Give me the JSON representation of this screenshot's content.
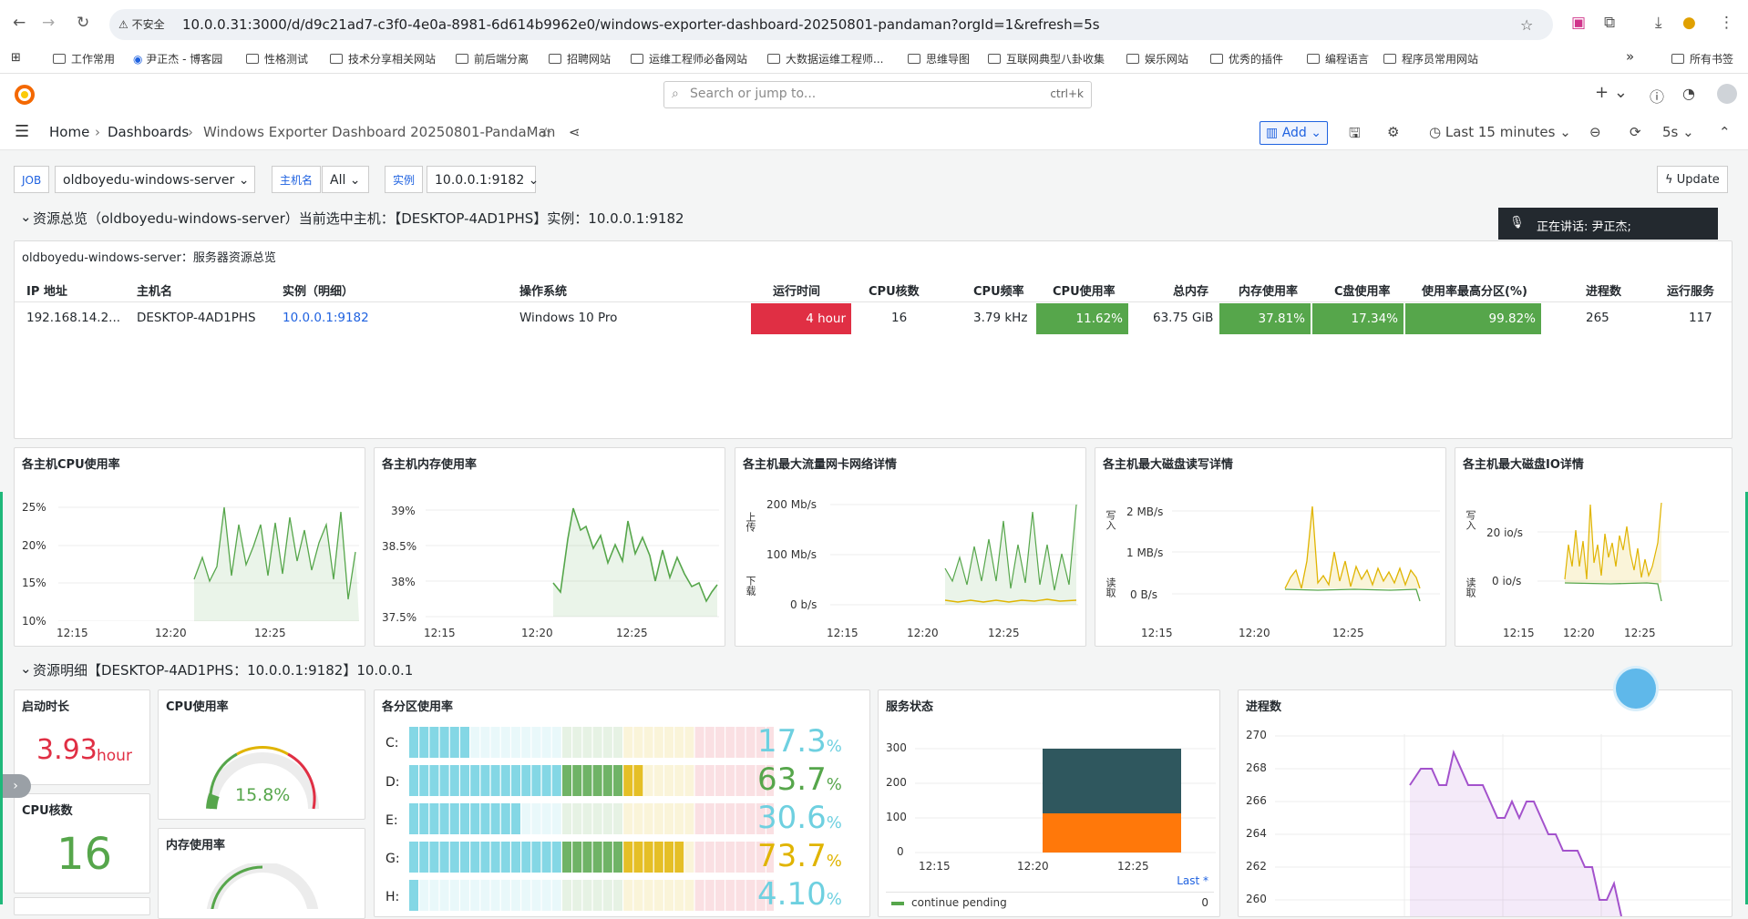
{
  "browser": {
    "insecure_label": "不安全",
    "url": "10.0.0.31:3000/d/d9c21ad7-c3f0-4e0a-8981-6d614b9962e0/windows-exporter-dashboard-20250801-pandaman?orgId=1&refresh=5s",
    "bookmarks": [
      "工作常用",
      "尹正杰 - 博客园",
      "性格测试",
      "技术分享相关网站",
      "前后端分离",
      "招聘网站",
      "运维工程师必备网站",
      "大数据运维工程师...",
      "思维导图",
      "互联网典型八卦收集",
      "娱乐网站",
      "优秀的插件",
      "编程语言",
      "程序员常用网站",
      "所有书签"
    ],
    "more": "»"
  },
  "topbar": {
    "search_placeholder": "Search or jump to...",
    "shortcut": "ctrl+k",
    "plus": "+"
  },
  "breadcrumb": {
    "home": "Home",
    "sep": "›",
    "dashboards": "Dashboards",
    "title": "Windows Exporter Dashboard 20250801-PandaMan"
  },
  "toolbar": {
    "add_label": "Add",
    "time_range": "Last 15 minutes",
    "refresh_interval": "5s",
    "update_label": "Update"
  },
  "variables": [
    {
      "label": "JOB",
      "value": "oldboyedu-windows-server"
    },
    {
      "label": "主机名",
      "value": "All"
    },
    {
      "label": "实例",
      "value": "10.0.0.1:9182"
    }
  ],
  "row1": {
    "title": "资源总览（oldboyedu-windows-server）当前选中主机：【DESKTOP-4AD1PHS】实例：10.0.0.1:9182"
  },
  "talk_overlay": {
    "text": "正在讲话:  尹正杰;"
  },
  "overview_table": {
    "title": "oldboyedu-windows-server：服务器资源总览",
    "headers": [
      "IP 地址",
      "主机名",
      "实例（明细）",
      "操作系统",
      "运行时间",
      "CPU核数",
      "CPU频率",
      "CPU使用率",
      "总内存",
      "内存使用率",
      "C盘使用率",
      "使用率最高分区(%)",
      "进程数",
      "运行服务"
    ],
    "row": [
      "192.168.14.2...",
      "DESKTOP-4AD1PHS",
      "10.0.0.1:9182",
      "Windows 10 Pro",
      "4 hour",
      "16",
      "3.79 kHz",
      "11.62%",
      "63.75 GiB",
      "37.81%",
      "17.34%",
      "99.82%",
      "265",
      "117"
    ],
    "colors": {
      "red": "#e02f44",
      "green": "#56a64b"
    }
  },
  "timeseries_panels": [
    {
      "title": "各主机CPU使用率",
      "yticks": [
        "25%",
        "20%",
        "15%",
        "10%"
      ],
      "xticks": [
        "12:15",
        "12:20",
        "12:25"
      ]
    },
    {
      "title": "各主机内存使用率",
      "yticks": [
        "39%",
        "38.5%",
        "38%",
        "37.5%"
      ],
      "xticks": [
        "12:15",
        "12:20",
        "12:25"
      ]
    },
    {
      "title": "各主机最大流量网卡网络详情",
      "yticks": [
        "200 Mb/s",
        "100 Mb/s",
        "0 b/s"
      ],
      "xticks": [
        "12:15",
        "12:20",
        "12:25"
      ],
      "axis_up": "上传",
      "axis_down": "下载"
    },
    {
      "title": "各主机最大磁盘读写详情",
      "yticks": [
        "2 MB/s",
        "1 MB/s",
        "0 B/s"
      ],
      "xticks": [
        "12:15",
        "12:20",
        "12:25"
      ],
      "axis_up": "写入",
      "axis_down": "读取"
    },
    {
      "title": "各主机最大磁盘IO详情",
      "yticks": [
        "20 io/s",
        "0 io/s"
      ],
      "xticks": [
        "12:15",
        "12:20",
        "12:25"
      ],
      "axis_up": "写入",
      "axis_down": "读取"
    }
  ],
  "row2": {
    "title": "资源明细【DESKTOP-4AD1PHS：10.0.0.1:9182】10.0.0.1"
  },
  "stats": {
    "uptime_title": "启动时长",
    "uptime_value": "3.93",
    "uptime_unit": "hour",
    "cpu_cores_title": "CPU核数",
    "cpu_cores_value": "16",
    "cpu_usage_title": "CPU使用率",
    "cpu_usage_value": "15.8%",
    "cpu_usage_fraction": 0.158,
    "mem_usage_title": "内存使用率"
  },
  "partitions": {
    "title": "各分区使用率",
    "items": [
      {
        "label": "C:",
        "value": "17.3",
        "color": "#6ed0e0"
      },
      {
        "label": "D:",
        "value": "63.7",
        "color": "#56a64b"
      },
      {
        "label": "E:",
        "value": "30.6",
        "color": "#6ed0e0"
      },
      {
        "label": "G:",
        "value": "73.7",
        "color": "#e0b400"
      },
      {
        "label": "H:",
        "value": "4.10",
        "color": "#6ed0e0"
      }
    ],
    "unit": "%"
  },
  "service_state": {
    "title": "服务状态",
    "yticks": [
      "300",
      "200",
      "100",
      "0"
    ],
    "xticks": [
      "12:15",
      "12:20",
      "12:25"
    ],
    "last_label": "Last *",
    "legend_item": "continue pending",
    "legend_value": "0",
    "colors": {
      "top": "#2f575e",
      "bottom": "#ff780a"
    }
  },
  "process_count": {
    "title": "进程数",
    "yticks": [
      "270",
      "268",
      "266",
      "264",
      "262",
      "260"
    ],
    "color": "#a352cc"
  }
}
